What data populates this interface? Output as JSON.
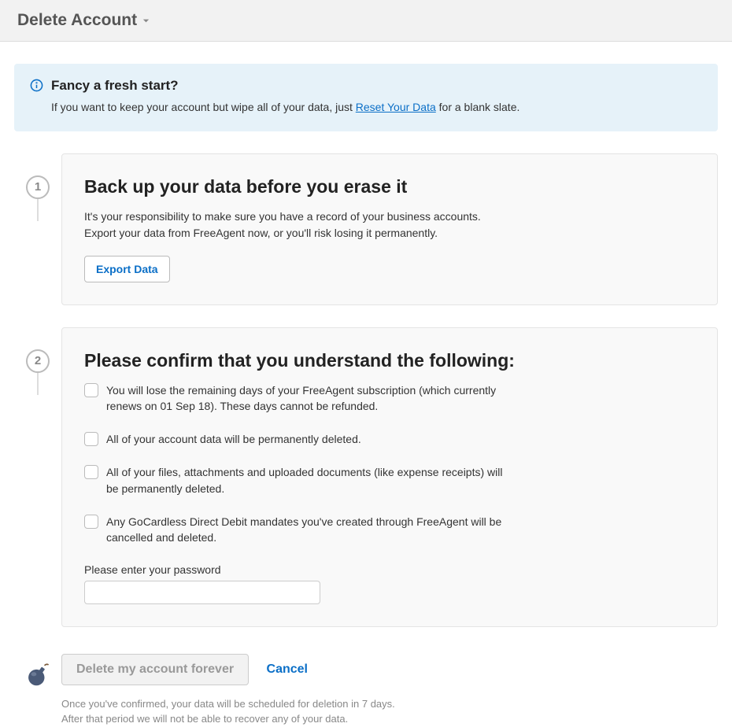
{
  "header": {
    "title": "Delete Account"
  },
  "info": {
    "title": "Fancy a fresh start?",
    "prefix": "If you want to keep your account but wipe all of your data, just ",
    "link": "Reset Your Data",
    "suffix": " for a blank slate."
  },
  "step1": {
    "number": "1",
    "title": "Back up your data before you erase it",
    "line1": "It's your responsibility to make sure you have a record of your business accounts.",
    "line2": "Export your data from FreeAgent now, or you'll risk losing it permanently.",
    "button": "Export Data"
  },
  "step2": {
    "number": "2",
    "title": "Please confirm that you understand the following:",
    "checks": [
      "You will lose the remaining days of your FreeAgent subscription (which currently renews on 01 Sep 18). These days cannot be refunded.",
      "All of your account data will be permanently deleted.",
      "All of your files, attachments and uploaded documents (like expense receipts) will be permanently deleted.",
      "Any GoCardless Direct Debit mandates you've created through FreeAgent will be cancelled and deleted."
    ],
    "password_label": "Please enter your password"
  },
  "final": {
    "delete_button": "Delete my account forever",
    "cancel": "Cancel",
    "note1": "Once you've confirmed, your data will be scheduled for deletion in 7 days.",
    "note2": "After that period we will not be able to recover any of your data."
  }
}
